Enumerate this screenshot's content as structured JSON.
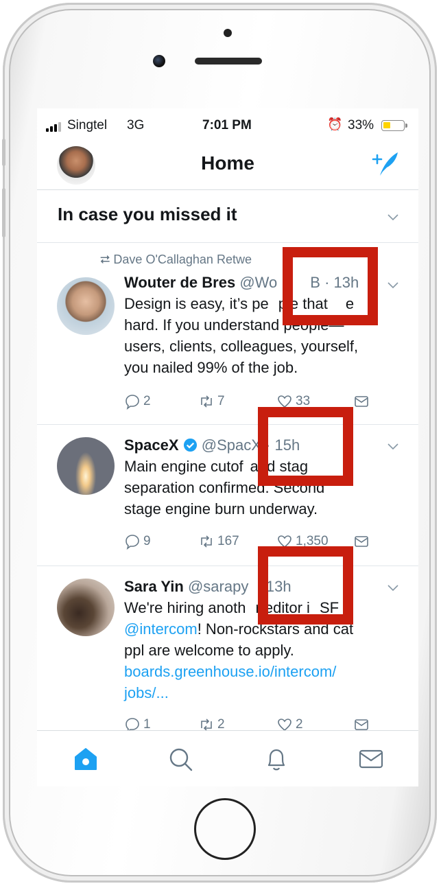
{
  "status_bar": {
    "carrier": "Singtel",
    "network": "3G",
    "time": "7:01 PM",
    "battery_percent": "33%",
    "battery_level": 0.33,
    "alarm_icon": "alarm-clock-icon"
  },
  "header": {
    "title": "Home",
    "compose_icon": "compose-tweet-icon"
  },
  "section": {
    "title": "In case you missed it"
  },
  "tweets": [
    {
      "retweet_context": "Dave O'Callaghan Retwe",
      "name": "Wouter de Bres",
      "handle": "@Wo",
      "handle_tail": "B",
      "separator": "·",
      "age": "13h",
      "lines": [
        "Design is easy, it’s pe",
        "ple that",
        "e",
        "hard. If you understand people—",
        "users, clients, colleagues, yourself,",
        "you nailed 99% of the job."
      ],
      "replies": "2",
      "retweets": "7",
      "likes": "33"
    },
    {
      "name": "SpaceX",
      "verified": true,
      "handle": "@Spac",
      "handle_tail": "X",
      "separator": "·",
      "age": "15h",
      "lines": [
        "Main engine cutof",
        "and stag",
        "separation confirmed. Second",
        "stage engine burn underway."
      ],
      "replies": "9",
      "retweets": "167",
      "likes": "1,350"
    },
    {
      "name": "Sara Yin",
      "handle": "@sarapy",
      "separator": "·",
      "age": "13h",
      "lines": [
        "We're hiring anoth",
        "r editor i",
        "SF",
        "! Non-rockstars and cat",
        "ppl are welcome to apply.",
        "boards.greenhouse.io/intercom/",
        "jobs/..."
      ],
      "mention": "@intercom",
      "replies": "1",
      "retweets": "2",
      "likes": "2"
    }
  ],
  "tab_bar": {
    "tabs": [
      "home-icon",
      "search-icon",
      "notifications-icon",
      "messages-icon"
    ],
    "active_color": "#1da1f2"
  },
  "colors": {
    "accent": "#1da1f2",
    "highlight_marker": "#c81e0e",
    "secondary_text": "#657786"
  }
}
